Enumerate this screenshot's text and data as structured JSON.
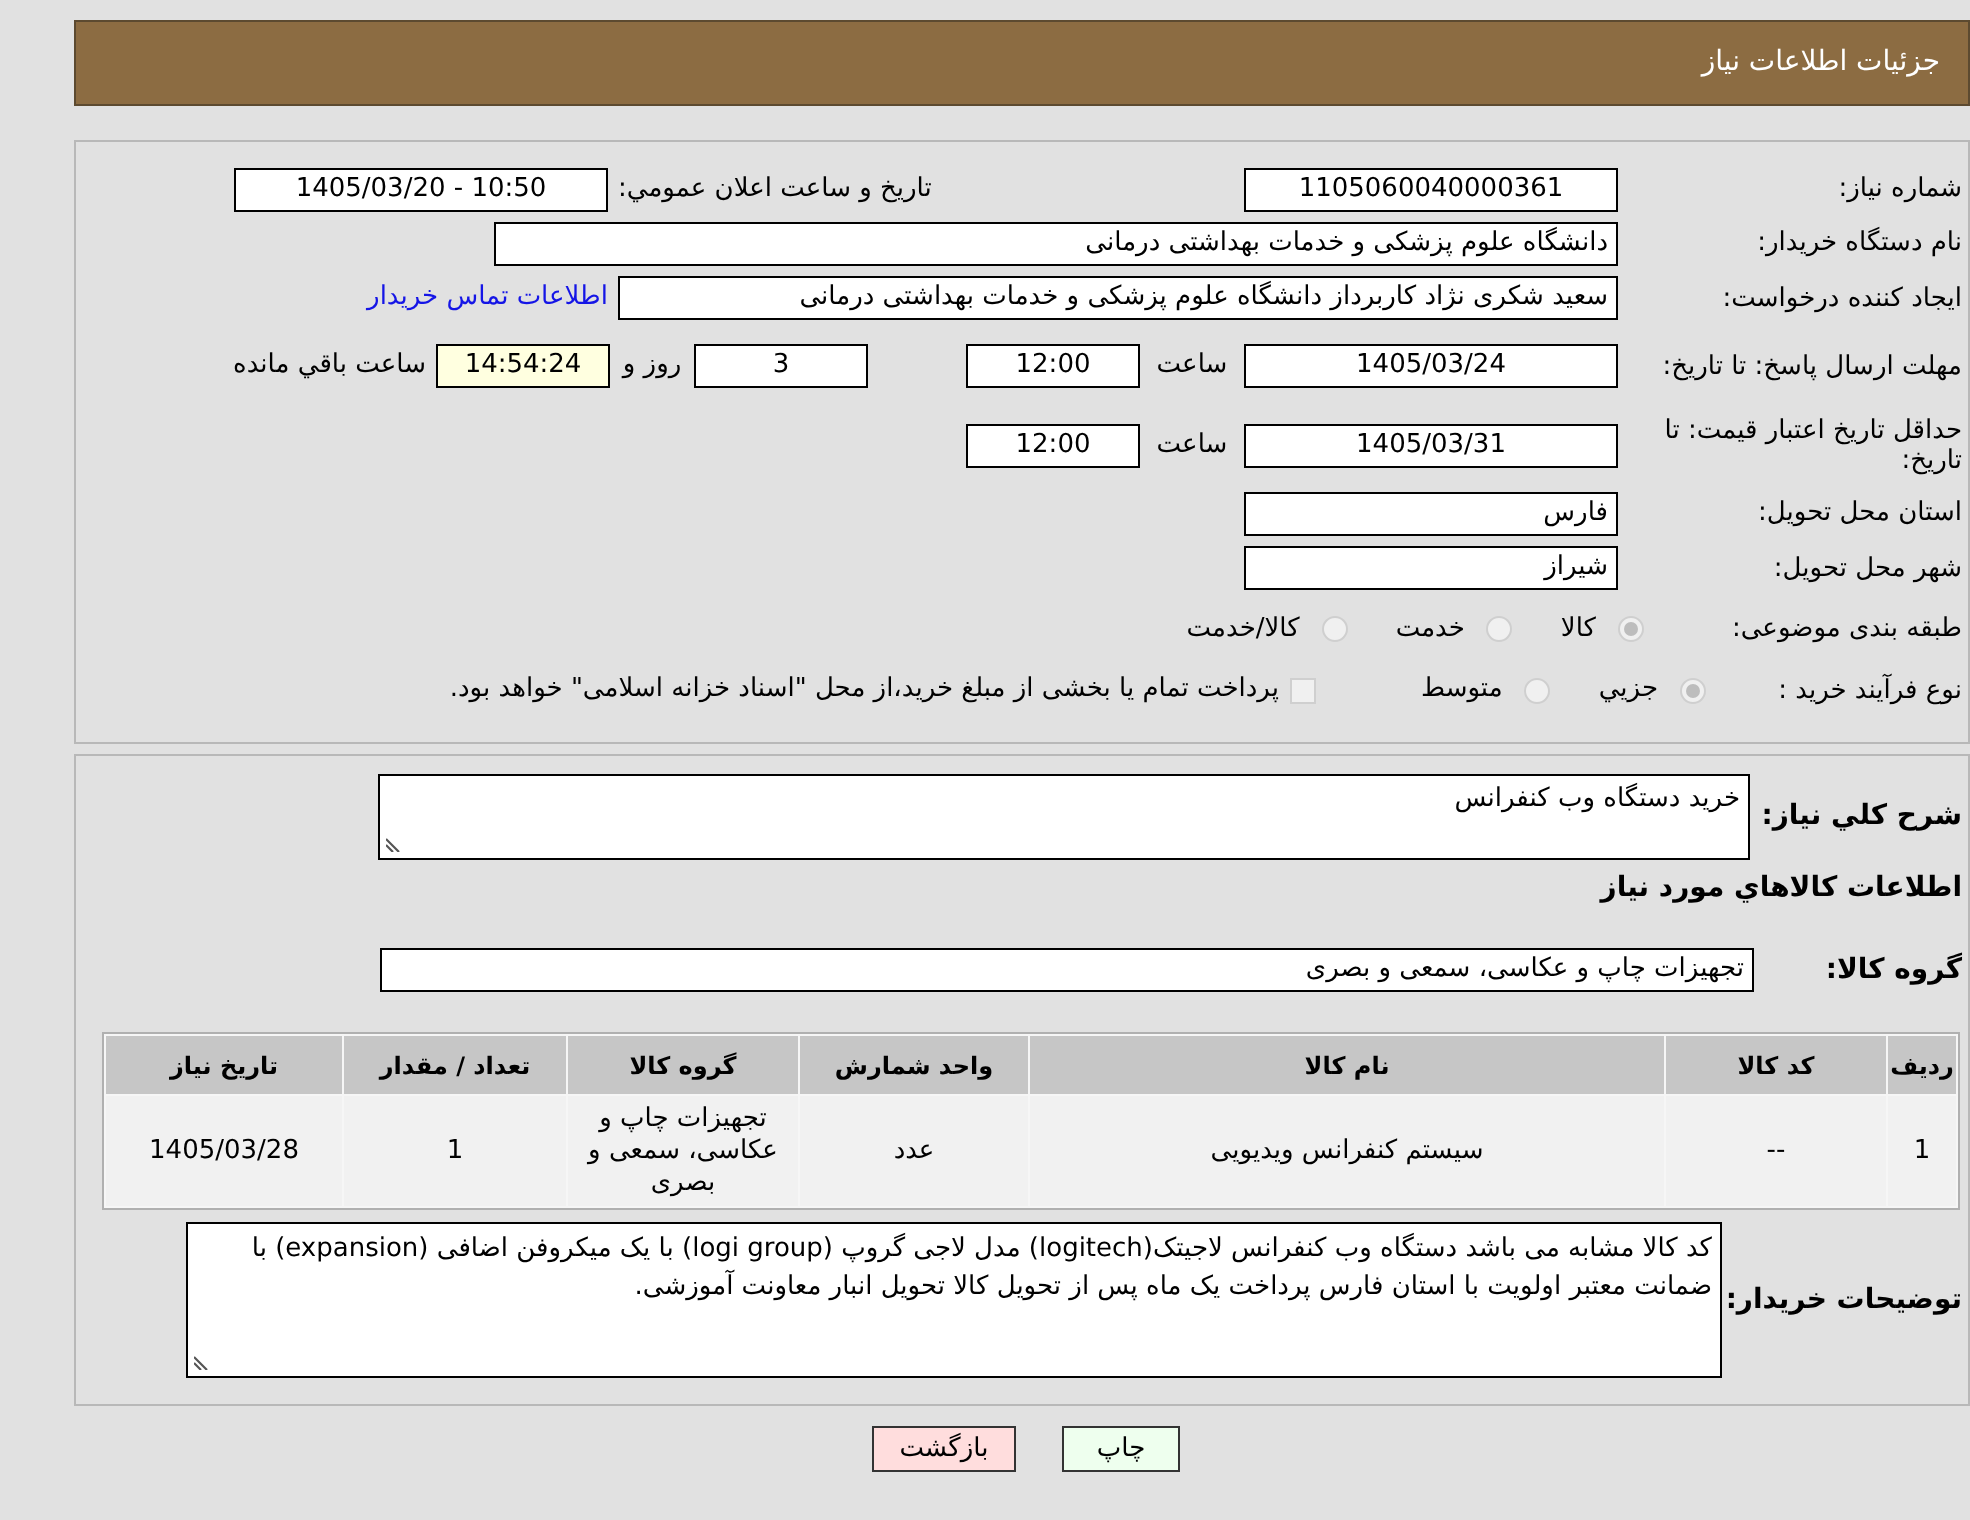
{
  "header": {
    "title": "جزئیات اطلاعات نیاز"
  },
  "need_info": {
    "need_number": {
      "label": "شماره نیاز:",
      "value": "1105060040000361"
    },
    "announce": {
      "label": "تاریخ و ساعت اعلان عمومي:",
      "value": "1405/03/20 - 10:50"
    },
    "buyer_org": {
      "label": "نام دستگاه خریدار:",
      "value": "دانشگاه علوم پزشکی و خدمات بهداشتی درمانی"
    },
    "requester": {
      "label": "ایجاد کننده درخواست:",
      "value": "سعید شکری نژاد کاربرداز دانشگاه علوم پزشکی و خدمات بهداشتی درمانی",
      "contact_link": "اطلاعات تماس خریدار"
    },
    "reply_deadline": {
      "label": "مهلت ارسال پاسخ: تا تاریخ:",
      "date": "1405/03/24",
      "time_label": "ساعت",
      "time": "12:00",
      "days": "3",
      "days_label": "روز و",
      "remaining": "14:54:24",
      "remaining_label": "ساعت باقي مانده"
    },
    "price_validity": {
      "label": "حداقل تاریخ اعتبار قیمت: تا تاریخ:",
      "date": "1405/03/31",
      "time_label": "ساعت",
      "time": "12:00"
    },
    "province": {
      "label": "استان محل تحویل:",
      "value": "فارس"
    },
    "city": {
      "label": "شهر محل تحویل:",
      "value": "شیراز"
    },
    "category": {
      "label": "طبقه بندی موضوعی:",
      "options": [
        {
          "label": "کالا",
          "selected": true
        },
        {
          "label": "خدمت",
          "selected": false
        },
        {
          "label": "کالا/خدمت",
          "selected": false
        }
      ]
    },
    "purchase_type": {
      "label": "نوع فرآیند خرید :",
      "options": [
        {
          "label": "جزيي",
          "selected": true
        },
        {
          "label": "متوسط",
          "selected": false
        }
      ],
      "treasury_payment": {
        "label": "پرداخت تمام یا بخشی از مبلغ خرید،از محل \"اسناد خزانه اسلامی\" خواهد بود.",
        "checked": false
      }
    }
  },
  "requirements": {
    "summary": {
      "label": "شرح کلي نیاز:",
      "value": "خرید دستگاه وب کنفرانس"
    },
    "goods_heading": "اطلاعات کالاهاي مورد نیاز",
    "goods_group": {
      "label": "گروه کالا:",
      "value": "تجهیزات چاپ و عکاسی، سمعی و بصری"
    },
    "table": {
      "columns": [
        "ردیف",
        "کد کالا",
        "نام کالا",
        "واحد شمارش",
        "گروه کالا",
        "تعداد / مقدار",
        "تاریخ نیاز"
      ],
      "rows": [
        [
          "1",
          "--",
          "سیستم کنفرانس ویدیویی",
          "عدد",
          "تجهیزات چاپ و عکاسی، سمعی و بصری",
          "1",
          "1405/03/28"
        ]
      ]
    },
    "buyer_notes": {
      "label": "توضیحات خریدار:",
      "value": "کد کالا مشابه می باشد دستگاه وب کنفرانس لاجیتک(logitech) مدل لاجی گروپ (logi group) با یک میکروفن اضافی (expansion) با ضمانت معتبر اولویت با استان فارس پرداخت یک ماه پس از تحویل کالا تحویل انبار معاونت آموزشی."
    }
  },
  "buttons": [
    {
      "label": "چاپ",
      "kind": "print"
    },
    {
      "label": "بازگشت",
      "kind": "back"
    }
  ]
}
